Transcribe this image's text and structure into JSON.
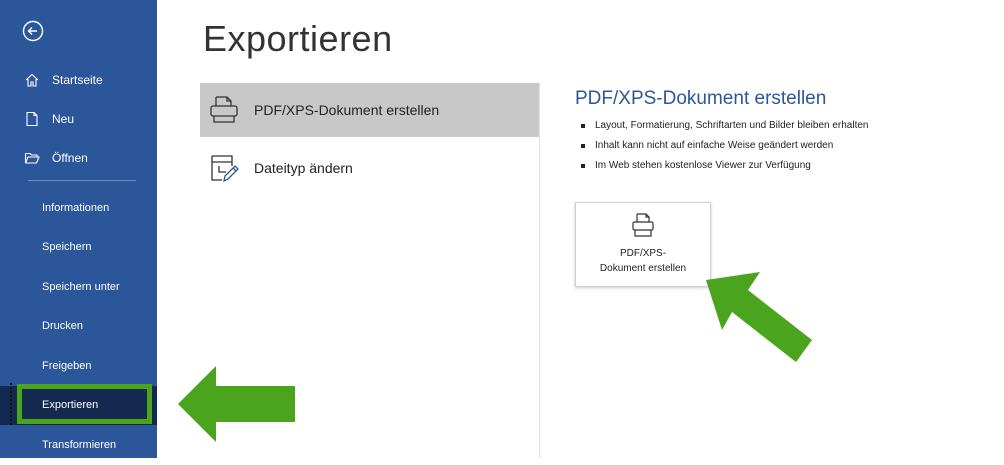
{
  "page": {
    "title": "Exportieren"
  },
  "sidebar": {
    "back_icon": "back-arrow-icon",
    "top_items": [
      {
        "label": "Startseite",
        "icon": "home-icon"
      },
      {
        "label": "Neu",
        "icon": "new-document-icon"
      },
      {
        "label": "Öffnen",
        "icon": "folder-open-icon"
      }
    ],
    "sub_items": [
      {
        "label": "Informationen"
      },
      {
        "label": "Speichern"
      },
      {
        "label": "Speichern unter"
      },
      {
        "label": "Drucken"
      },
      {
        "label": "Freigeben"
      },
      {
        "label": "Exportieren",
        "active": true
      },
      {
        "label": "Transformieren"
      }
    ],
    "accent": "#2b579a",
    "active_bg": "#14294f"
  },
  "options": [
    {
      "label": "PDF/XPS-Dokument erstellen",
      "icon": "pdf-document-icon",
      "selected": true
    },
    {
      "label": "Dateityp ändern",
      "icon": "change-filetype-icon",
      "selected": false
    }
  ],
  "detail": {
    "heading": "PDF/XPS-Dokument erstellen",
    "bullets": [
      "Layout, Formatierung, Schriftarten und Bilder bleiben erhalten",
      "Inhalt kann nicht auf einfache Weise geändert werden",
      "Im Web stehen kostenlose Viewer zur Verfügung"
    ],
    "button": {
      "line1": "PDF/XPS-",
      "line2": "Dokument erstellen",
      "icon": "pdf-document-icon"
    }
  },
  "annotations": {
    "arrow_color": "#4aa41d"
  }
}
